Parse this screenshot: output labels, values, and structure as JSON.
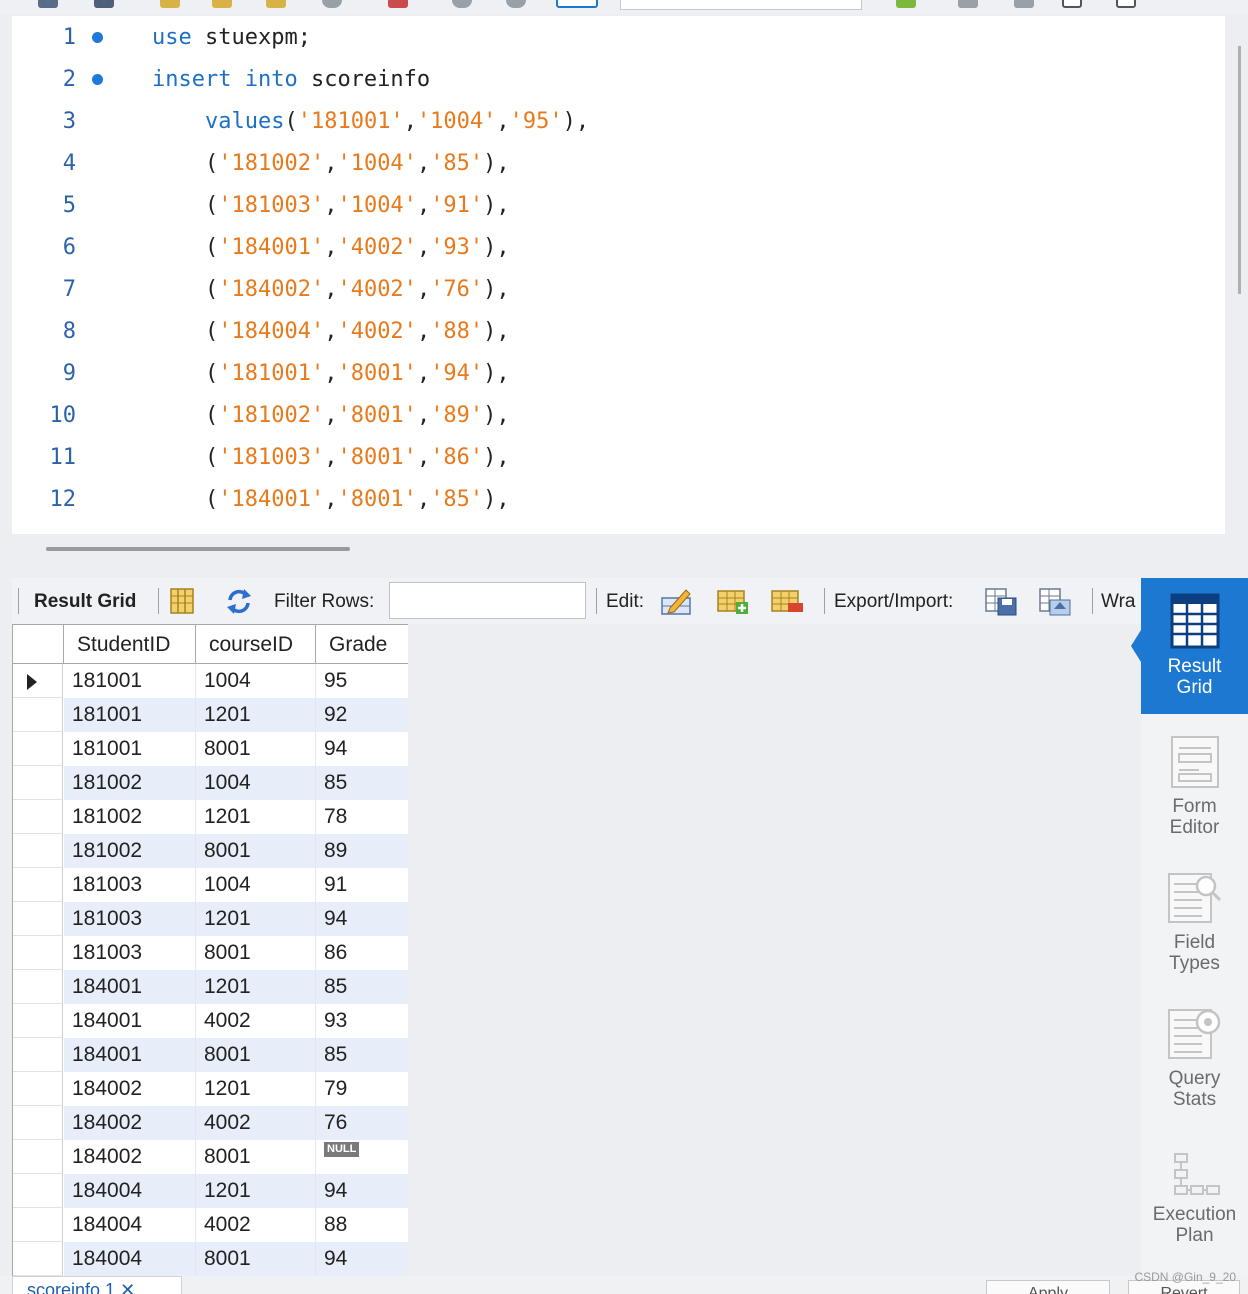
{
  "editor": {
    "lines": [
      {
        "num": "1",
        "marker": true,
        "segments": [
          {
            "t": "kw",
            "v": "use"
          },
          {
            "t": "pl",
            "v": " stuexpm;"
          }
        ]
      },
      {
        "num": "2",
        "marker": true,
        "segments": [
          {
            "t": "kw",
            "v": "insert into"
          },
          {
            "t": "pl",
            "v": " scoreinfo"
          }
        ]
      },
      {
        "num": "3",
        "marker": false,
        "segments": [
          {
            "t": "pl",
            "v": "    "
          },
          {
            "t": "kw",
            "v": "values"
          },
          {
            "t": "pl",
            "v": "("
          },
          {
            "t": "st",
            "v": "'181001'"
          },
          {
            "t": "pl",
            "v": ","
          },
          {
            "t": "st",
            "v": "'1004'"
          },
          {
            "t": "pl",
            "v": ","
          },
          {
            "t": "st",
            "v": "'95'"
          },
          {
            "t": "pl",
            "v": "),"
          }
        ]
      },
      {
        "num": "4",
        "marker": false,
        "segments": [
          {
            "t": "pl",
            "v": "    ("
          },
          {
            "t": "st",
            "v": "'181002'"
          },
          {
            "t": "pl",
            "v": ","
          },
          {
            "t": "st",
            "v": "'1004'"
          },
          {
            "t": "pl",
            "v": ","
          },
          {
            "t": "st",
            "v": "'85'"
          },
          {
            "t": "pl",
            "v": "),"
          }
        ]
      },
      {
        "num": "5",
        "marker": false,
        "segments": [
          {
            "t": "pl",
            "v": "    ("
          },
          {
            "t": "st",
            "v": "'181003'"
          },
          {
            "t": "pl",
            "v": ","
          },
          {
            "t": "st",
            "v": "'1004'"
          },
          {
            "t": "pl",
            "v": ","
          },
          {
            "t": "st",
            "v": "'91'"
          },
          {
            "t": "pl",
            "v": "),"
          }
        ]
      },
      {
        "num": "6",
        "marker": false,
        "segments": [
          {
            "t": "pl",
            "v": "    ("
          },
          {
            "t": "st",
            "v": "'184001'"
          },
          {
            "t": "pl",
            "v": ","
          },
          {
            "t": "st",
            "v": "'4002'"
          },
          {
            "t": "pl",
            "v": ","
          },
          {
            "t": "st",
            "v": "'93'"
          },
          {
            "t": "pl",
            "v": "),"
          }
        ]
      },
      {
        "num": "7",
        "marker": false,
        "segments": [
          {
            "t": "pl",
            "v": "    ("
          },
          {
            "t": "st",
            "v": "'184002'"
          },
          {
            "t": "pl",
            "v": ","
          },
          {
            "t": "st",
            "v": "'4002'"
          },
          {
            "t": "pl",
            "v": ","
          },
          {
            "t": "st",
            "v": "'76'"
          },
          {
            "t": "pl",
            "v": "),"
          }
        ]
      },
      {
        "num": "8",
        "marker": false,
        "segments": [
          {
            "t": "pl",
            "v": "    ("
          },
          {
            "t": "st",
            "v": "'184004'"
          },
          {
            "t": "pl",
            "v": ","
          },
          {
            "t": "st",
            "v": "'4002'"
          },
          {
            "t": "pl",
            "v": ","
          },
          {
            "t": "st",
            "v": "'88'"
          },
          {
            "t": "pl",
            "v": "),"
          }
        ]
      },
      {
        "num": "9",
        "marker": false,
        "segments": [
          {
            "t": "pl",
            "v": "    ("
          },
          {
            "t": "st",
            "v": "'181001'"
          },
          {
            "t": "pl",
            "v": ","
          },
          {
            "t": "st",
            "v": "'8001'"
          },
          {
            "t": "pl",
            "v": ","
          },
          {
            "t": "st",
            "v": "'94'"
          },
          {
            "t": "pl",
            "v": "),"
          }
        ]
      },
      {
        "num": "10",
        "marker": false,
        "segments": [
          {
            "t": "pl",
            "v": "    ("
          },
          {
            "t": "st",
            "v": "'181002'"
          },
          {
            "t": "pl",
            "v": ","
          },
          {
            "t": "st",
            "v": "'8001'"
          },
          {
            "t": "pl",
            "v": ","
          },
          {
            "t": "st",
            "v": "'89'"
          },
          {
            "t": "pl",
            "v": "),"
          }
        ]
      },
      {
        "num": "11",
        "marker": false,
        "segments": [
          {
            "t": "pl",
            "v": "    ("
          },
          {
            "t": "st",
            "v": "'181003'"
          },
          {
            "t": "pl",
            "v": ","
          },
          {
            "t": "st",
            "v": "'8001'"
          },
          {
            "t": "pl",
            "v": ","
          },
          {
            "t": "st",
            "v": "'86'"
          },
          {
            "t": "pl",
            "v": "),"
          }
        ]
      },
      {
        "num": "12",
        "marker": false,
        "segments": [
          {
            "t": "pl",
            "v": "    ("
          },
          {
            "t": "st",
            "v": "'184001'"
          },
          {
            "t": "pl",
            "v": ","
          },
          {
            "t": "st",
            "v": "'8001'"
          },
          {
            "t": "pl",
            "v": ","
          },
          {
            "t": "st",
            "v": "'85'"
          },
          {
            "t": "pl",
            "v": "),"
          }
        ]
      }
    ]
  },
  "result_toolbar": {
    "result_grid_label": "Result Grid",
    "filter_rows_label": "Filter Rows:",
    "filter_value": "",
    "edit_label": "Edit:",
    "export_import_label": "Export/Import:",
    "wrap_label": "Wra"
  },
  "grid": {
    "columns": [
      "StudentID",
      "courseID",
      "Grade"
    ],
    "null_label": "NULL",
    "rows": [
      [
        "181001",
        "1004",
        "95"
      ],
      [
        "181001",
        "1201",
        "92"
      ],
      [
        "181001",
        "8001",
        "94"
      ],
      [
        "181002",
        "1004",
        "85"
      ],
      [
        "181002",
        "1201",
        "78"
      ],
      [
        "181002",
        "8001",
        "89"
      ],
      [
        "181003",
        "1004",
        "91"
      ],
      [
        "181003",
        "1201",
        "94"
      ],
      [
        "181003",
        "8001",
        "86"
      ],
      [
        "184001",
        "1201",
        "85"
      ],
      [
        "184001",
        "4002",
        "93"
      ],
      [
        "184001",
        "8001",
        "85"
      ],
      [
        "184002",
        "1201",
        "79"
      ],
      [
        "184002",
        "4002",
        "76"
      ],
      [
        "184002",
        "8001",
        null
      ],
      [
        "184004",
        "1201",
        "94"
      ],
      [
        "184004",
        "4002",
        "88"
      ],
      [
        "184004",
        "8001",
        "94"
      ]
    ]
  },
  "side_panel": {
    "items": [
      {
        "name": "result-grid",
        "lines": [
          "Result",
          "Grid"
        ],
        "active": true,
        "icon": "grid-icon"
      },
      {
        "name": "form-editor",
        "lines": [
          "Form",
          "Editor"
        ],
        "active": false,
        "icon": "form-icon"
      },
      {
        "name": "field-types",
        "lines": [
          "Field",
          "Types"
        ],
        "active": false,
        "icon": "field-types-icon"
      },
      {
        "name": "query-stats",
        "lines": [
          "Query",
          "Stats"
        ],
        "active": false,
        "icon": "query-stats-icon"
      },
      {
        "name": "execution-plan",
        "lines": [
          "Execution",
          "Plan"
        ],
        "active": false,
        "icon": "execution-plan-icon"
      }
    ]
  },
  "bottom_bar": {
    "tab_label": "scoreinfo 1",
    "apply_label": "Apply",
    "revert_label": "Revert"
  },
  "watermark": "CSDN @Gin_9_20",
  "colors": {
    "keyword": "#1e6fc8",
    "string": "#e87a1c",
    "accent": "#1c78d0",
    "alt_row": "#e8eef9"
  }
}
